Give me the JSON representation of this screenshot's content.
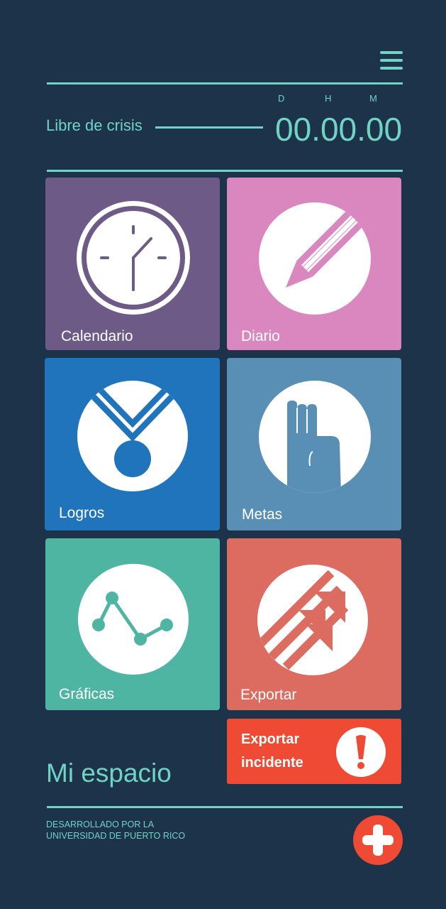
{
  "header": {
    "menu_icon": "hamburger-menu-icon"
  },
  "crisis": {
    "label": "Libre de crisis",
    "units": {
      "d": "D",
      "h": "H",
      "m": "M"
    },
    "timer": "00.00.00"
  },
  "tiles": [
    {
      "label": "Calendario",
      "icon": "clock-icon",
      "color": "#6d5a86"
    },
    {
      "label": "Diario",
      "icon": "pencil-icon",
      "color": "#da87c0"
    },
    {
      "label": "Logros",
      "icon": "medal-icon",
      "color": "#1f74bb"
    },
    {
      "label": "Metas",
      "icon": "hand-icon",
      "color": "#5a8fb5"
    },
    {
      "label": "Gráficas",
      "icon": "line-graph-icon",
      "color": "#4fb5a3"
    },
    {
      "label": "Exportar",
      "icon": "arrows-up-right-icon",
      "color": "#dc6b60"
    }
  ],
  "section_title": "Mi espacio",
  "export_incident": {
    "line1": "Exportar",
    "line2": "incidente",
    "icon": "exclamation-icon",
    "color": "#ef4a34"
  },
  "footer": {
    "credit_line1": "DESARROLLADO POR LA",
    "credit_line2": "UNIVERSIDAD DE PUERTO RICO",
    "add_icon": "plus-icon"
  },
  "colors": {
    "background": "#1c3349",
    "accent": "#6fd3c5"
  }
}
